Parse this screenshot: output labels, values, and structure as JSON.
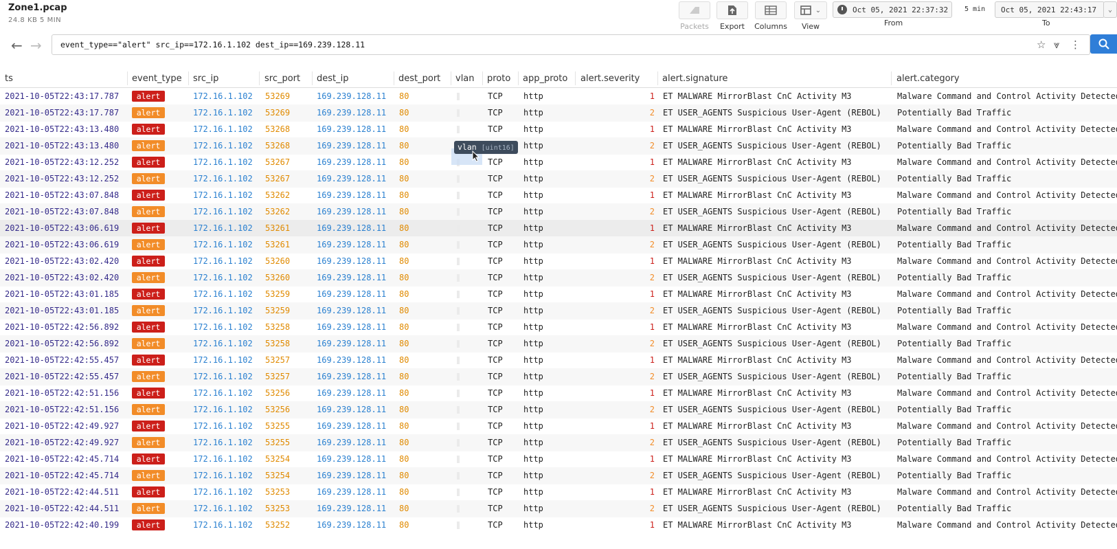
{
  "file": {
    "name": "Zone1.pcap",
    "meta": "24.8 KB  5 MIN"
  },
  "toolbar": {
    "packets": "Packets",
    "export": "Export",
    "columns": "Columns",
    "view": "View"
  },
  "time": {
    "from_value": "Oct 05, 2021 22:37:32",
    "duration": "5 min",
    "to_value": "Oct 05, 2021 22:43:17",
    "from_label": "From",
    "to_label": "To"
  },
  "query": "event_type==\"alert\" src_ip==172.16.1.102 dest_ip==169.239.128.11",
  "icons": [
    "back-arrow-icon",
    "forward-arrow-icon",
    "star-icon",
    "pin-icon",
    "more-vert-icon",
    "search-icon",
    "clock-icon",
    "packets-icon",
    "export-icon",
    "columns-icon",
    "view-icon",
    "chevron-down-icon"
  ],
  "colors": {
    "sev1": "#cc1f1a",
    "sev2": "#f28c28",
    "accent": "#2f7ed8"
  },
  "columns": [
    "ts",
    "event_type",
    "src_ip",
    "src_port",
    "dest_ip",
    "dest_port",
    "vlan",
    "proto",
    "app_proto",
    "alert.severity",
    "alert.signature",
    "alert.category"
  ],
  "tooltip": {
    "field": "vlan",
    "type": "[uint16]"
  },
  "rows": [
    {
      "ts": "2021-10-05T22:43:17.787",
      "event_type": "alert",
      "src_ip": "172.16.1.102",
      "src_port": "53269",
      "dest_ip": "169.239.128.11",
      "dest_port": "80",
      "proto": "TCP",
      "app_proto": "http",
      "severity": "1",
      "signature": "ET MALWARE MirrorBlast CnC Activity M3",
      "category": "Malware Command and Control Activity Detected"
    },
    {
      "ts": "2021-10-05T22:43:17.787",
      "event_type": "alert",
      "src_ip": "172.16.1.102",
      "src_port": "53269",
      "dest_ip": "169.239.128.11",
      "dest_port": "80",
      "proto": "TCP",
      "app_proto": "http",
      "severity": "2",
      "signature": "ET USER_AGENTS Suspicious User-Agent (REBOL)",
      "category": "Potentially Bad Traffic"
    },
    {
      "ts": "2021-10-05T22:43:13.480",
      "event_type": "alert",
      "src_ip": "172.16.1.102",
      "src_port": "53268",
      "dest_ip": "169.239.128.11",
      "dest_port": "80",
      "proto": "TCP",
      "app_proto": "http",
      "severity": "1",
      "signature": "ET MALWARE MirrorBlast CnC Activity M3",
      "category": "Malware Command and Control Activity Detected"
    },
    {
      "ts": "2021-10-05T22:43:13.480",
      "event_type": "alert",
      "src_ip": "172.16.1.102",
      "src_port": "53268",
      "dest_ip": "169.239.128.11",
      "dest_port": "80",
      "proto": "TCP",
      "app_proto": "http",
      "severity": "2",
      "signature": "ET USER_AGENTS Suspicious User-Agent (REBOL)",
      "category": "Potentially Bad Traffic"
    },
    {
      "ts": "2021-10-05T22:43:12.252",
      "event_type": "alert",
      "src_ip": "172.16.1.102",
      "src_port": "53267",
      "dest_ip": "169.239.128.11",
      "dest_port": "80",
      "proto": "TCP",
      "app_proto": "http",
      "severity": "1",
      "signature": "ET MALWARE MirrorBlast CnC Activity M3",
      "category": "Malware Command and Control Activity Detected"
    },
    {
      "ts": "2021-10-05T22:43:12.252",
      "event_type": "alert",
      "src_ip": "172.16.1.102",
      "src_port": "53267",
      "dest_ip": "169.239.128.11",
      "dest_port": "80",
      "proto": "TCP",
      "app_proto": "http",
      "severity": "2",
      "signature": "ET USER_AGENTS Suspicious User-Agent (REBOL)",
      "category": "Potentially Bad Traffic"
    },
    {
      "ts": "2021-10-05T22:43:07.848",
      "event_type": "alert",
      "src_ip": "172.16.1.102",
      "src_port": "53262",
      "dest_ip": "169.239.128.11",
      "dest_port": "80",
      "proto": "TCP",
      "app_proto": "http",
      "severity": "1",
      "signature": "ET MALWARE MirrorBlast CnC Activity M3",
      "category": "Malware Command and Control Activity Detected"
    },
    {
      "ts": "2021-10-05T22:43:07.848",
      "event_type": "alert",
      "src_ip": "172.16.1.102",
      "src_port": "53262",
      "dest_ip": "169.239.128.11",
      "dest_port": "80",
      "proto": "TCP",
      "app_proto": "http",
      "severity": "2",
      "signature": "ET USER_AGENTS Suspicious User-Agent (REBOL)",
      "category": "Potentially Bad Traffic"
    },
    {
      "ts": "2021-10-05T22:43:06.619",
      "event_type": "alert",
      "src_ip": "172.16.1.102",
      "src_port": "53261",
      "dest_ip": "169.239.128.11",
      "dest_port": "80",
      "proto": "TCP",
      "app_proto": "http",
      "severity": "1",
      "signature": "ET MALWARE MirrorBlast CnC Activity M3",
      "category": "Malware Command and Control Activity Detected"
    },
    {
      "ts": "2021-10-05T22:43:06.619",
      "event_type": "alert",
      "src_ip": "172.16.1.102",
      "src_port": "53261",
      "dest_ip": "169.239.128.11",
      "dest_port": "80",
      "proto": "TCP",
      "app_proto": "http",
      "severity": "2",
      "signature": "ET USER_AGENTS Suspicious User-Agent (REBOL)",
      "category": "Potentially Bad Traffic"
    },
    {
      "ts": "2021-10-05T22:43:02.420",
      "event_type": "alert",
      "src_ip": "172.16.1.102",
      "src_port": "53260",
      "dest_ip": "169.239.128.11",
      "dest_port": "80",
      "proto": "TCP",
      "app_proto": "http",
      "severity": "1",
      "signature": "ET MALWARE MirrorBlast CnC Activity M3",
      "category": "Malware Command and Control Activity Detected"
    },
    {
      "ts": "2021-10-05T22:43:02.420",
      "event_type": "alert",
      "src_ip": "172.16.1.102",
      "src_port": "53260",
      "dest_ip": "169.239.128.11",
      "dest_port": "80",
      "proto": "TCP",
      "app_proto": "http",
      "severity": "2",
      "signature": "ET USER_AGENTS Suspicious User-Agent (REBOL)",
      "category": "Potentially Bad Traffic"
    },
    {
      "ts": "2021-10-05T22:43:01.185",
      "event_type": "alert",
      "src_ip": "172.16.1.102",
      "src_port": "53259",
      "dest_ip": "169.239.128.11",
      "dest_port": "80",
      "proto": "TCP",
      "app_proto": "http",
      "severity": "1",
      "signature": "ET MALWARE MirrorBlast CnC Activity M3",
      "category": "Malware Command and Control Activity Detected"
    },
    {
      "ts": "2021-10-05T22:43:01.185",
      "event_type": "alert",
      "src_ip": "172.16.1.102",
      "src_port": "53259",
      "dest_ip": "169.239.128.11",
      "dest_port": "80",
      "proto": "TCP",
      "app_proto": "http",
      "severity": "2",
      "signature": "ET USER_AGENTS Suspicious User-Agent (REBOL)",
      "category": "Potentially Bad Traffic"
    },
    {
      "ts": "2021-10-05T22:42:56.892",
      "event_type": "alert",
      "src_ip": "172.16.1.102",
      "src_port": "53258",
      "dest_ip": "169.239.128.11",
      "dest_port": "80",
      "proto": "TCP",
      "app_proto": "http",
      "severity": "1",
      "signature": "ET MALWARE MirrorBlast CnC Activity M3",
      "category": "Malware Command and Control Activity Detected"
    },
    {
      "ts": "2021-10-05T22:42:56.892",
      "event_type": "alert",
      "src_ip": "172.16.1.102",
      "src_port": "53258",
      "dest_ip": "169.239.128.11",
      "dest_port": "80",
      "proto": "TCP",
      "app_proto": "http",
      "severity": "2",
      "signature": "ET USER_AGENTS Suspicious User-Agent (REBOL)",
      "category": "Potentially Bad Traffic"
    },
    {
      "ts": "2021-10-05T22:42:55.457",
      "event_type": "alert",
      "src_ip": "172.16.1.102",
      "src_port": "53257",
      "dest_ip": "169.239.128.11",
      "dest_port": "80",
      "proto": "TCP",
      "app_proto": "http",
      "severity": "1",
      "signature": "ET MALWARE MirrorBlast CnC Activity M3",
      "category": "Malware Command and Control Activity Detected"
    },
    {
      "ts": "2021-10-05T22:42:55.457",
      "event_type": "alert",
      "src_ip": "172.16.1.102",
      "src_port": "53257",
      "dest_ip": "169.239.128.11",
      "dest_port": "80",
      "proto": "TCP",
      "app_proto": "http",
      "severity": "2",
      "signature": "ET USER_AGENTS Suspicious User-Agent (REBOL)",
      "category": "Potentially Bad Traffic"
    },
    {
      "ts": "2021-10-05T22:42:51.156",
      "event_type": "alert",
      "src_ip": "172.16.1.102",
      "src_port": "53256",
      "dest_ip": "169.239.128.11",
      "dest_port": "80",
      "proto": "TCP",
      "app_proto": "http",
      "severity": "1",
      "signature": "ET MALWARE MirrorBlast CnC Activity M3",
      "category": "Malware Command and Control Activity Detected"
    },
    {
      "ts": "2021-10-05T22:42:51.156",
      "event_type": "alert",
      "src_ip": "172.16.1.102",
      "src_port": "53256",
      "dest_ip": "169.239.128.11",
      "dest_port": "80",
      "proto": "TCP",
      "app_proto": "http",
      "severity": "2",
      "signature": "ET USER_AGENTS Suspicious User-Agent (REBOL)",
      "category": "Potentially Bad Traffic"
    },
    {
      "ts": "2021-10-05T22:42:49.927",
      "event_type": "alert",
      "src_ip": "172.16.1.102",
      "src_port": "53255",
      "dest_ip": "169.239.128.11",
      "dest_port": "80",
      "proto": "TCP",
      "app_proto": "http",
      "severity": "1",
      "signature": "ET MALWARE MirrorBlast CnC Activity M3",
      "category": "Malware Command and Control Activity Detected"
    },
    {
      "ts": "2021-10-05T22:42:49.927",
      "event_type": "alert",
      "src_ip": "172.16.1.102",
      "src_port": "53255",
      "dest_ip": "169.239.128.11",
      "dest_port": "80",
      "proto": "TCP",
      "app_proto": "http",
      "severity": "2",
      "signature": "ET USER_AGENTS Suspicious User-Agent (REBOL)",
      "category": "Potentially Bad Traffic"
    },
    {
      "ts": "2021-10-05T22:42:45.714",
      "event_type": "alert",
      "src_ip": "172.16.1.102",
      "src_port": "53254",
      "dest_ip": "169.239.128.11",
      "dest_port": "80",
      "proto": "TCP",
      "app_proto": "http",
      "severity": "1",
      "signature": "ET MALWARE MirrorBlast CnC Activity M3",
      "category": "Malware Command and Control Activity Detected"
    },
    {
      "ts": "2021-10-05T22:42:45.714",
      "event_type": "alert",
      "src_ip": "172.16.1.102",
      "src_port": "53254",
      "dest_ip": "169.239.128.11",
      "dest_port": "80",
      "proto": "TCP",
      "app_proto": "http",
      "severity": "2",
      "signature": "ET USER_AGENTS Suspicious User-Agent (REBOL)",
      "category": "Potentially Bad Traffic"
    },
    {
      "ts": "2021-10-05T22:42:44.511",
      "event_type": "alert",
      "src_ip": "172.16.1.102",
      "src_port": "53253",
      "dest_ip": "169.239.128.11",
      "dest_port": "80",
      "proto": "TCP",
      "app_proto": "http",
      "severity": "1",
      "signature": "ET MALWARE MirrorBlast CnC Activity M3",
      "category": "Malware Command and Control Activity Detected"
    },
    {
      "ts": "2021-10-05T22:42:44.511",
      "event_type": "alert",
      "src_ip": "172.16.1.102",
      "src_port": "53253",
      "dest_ip": "169.239.128.11",
      "dest_port": "80",
      "proto": "TCP",
      "app_proto": "http",
      "severity": "2",
      "signature": "ET USER_AGENTS Suspicious User-Agent (REBOL)",
      "category": "Potentially Bad Traffic"
    },
    {
      "ts": "2021-10-05T22:42:40.199",
      "event_type": "alert",
      "src_ip": "172.16.1.102",
      "src_port": "53252",
      "dest_ip": "169.239.128.11",
      "dest_port": "80",
      "proto": "TCP",
      "app_proto": "http",
      "severity": "1",
      "signature": "ET MALWARE MirrorBlast CnC Activity M3",
      "category": "Malware Command and Control Activity Detected"
    }
  ]
}
